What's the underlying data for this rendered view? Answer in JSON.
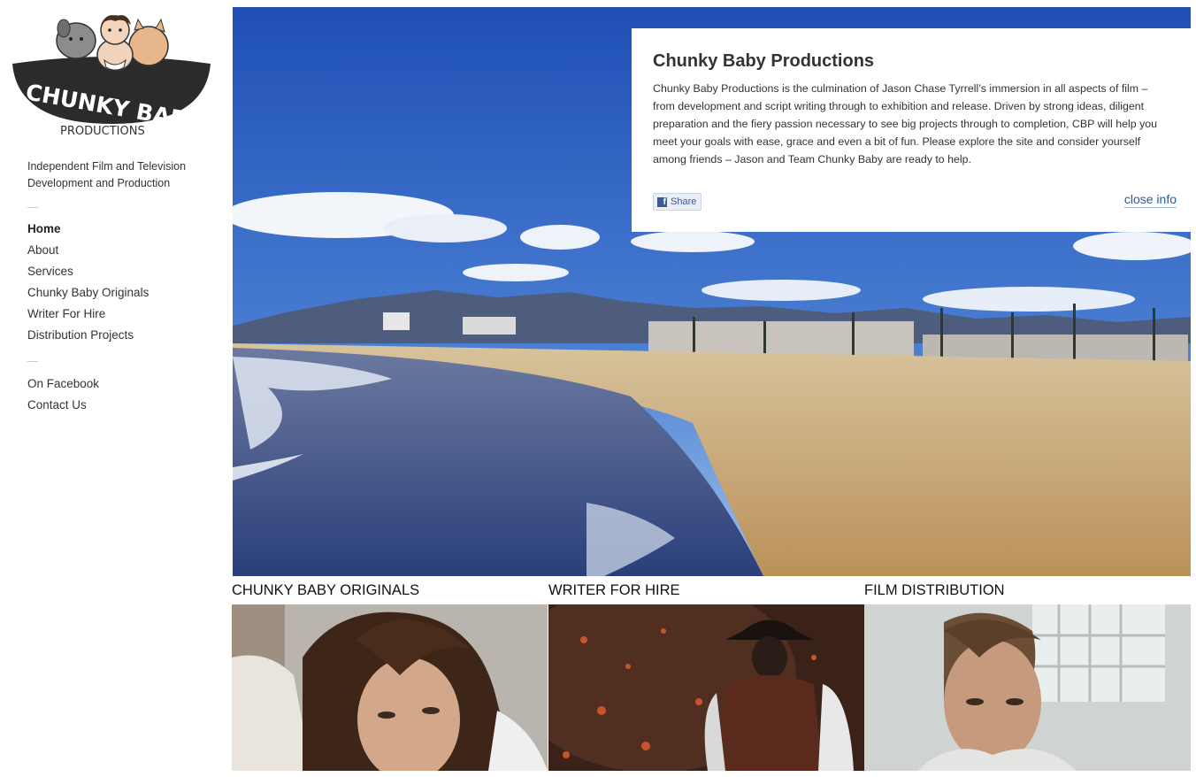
{
  "logo": {
    "top_text": "CHUNKY BABY",
    "bottom_text": "PRODUCTIONS"
  },
  "sidebar": {
    "tagline": "Independent Film and Television Development and Production",
    "nav": [
      {
        "label": "Home",
        "active": true
      },
      {
        "label": "About"
      },
      {
        "label": "Services"
      },
      {
        "label": "Chunky Baby Originals"
      },
      {
        "label": "Writer For Hire"
      },
      {
        "label": "Distribution Projects"
      }
    ],
    "social": [
      {
        "label": "On Facebook"
      },
      {
        "label": "Contact Us"
      }
    ]
  },
  "info": {
    "title": "Chunky Baby Productions",
    "body": "Chunky Baby Productions is the culmination of Jason Chase Tyrrell’s immersion in all aspects of film – from development and script writing through to exhibition and release. Driven by strong ideas, diligent preparation and the fiery passion necessary to see big projects through to completion, CBP will help you meet your goals with ease, grace and even a bit of fun. Please explore the site and consider yourself among friends – Jason and Team Chunky Baby are ready to help.",
    "share_label": "Share",
    "close_label": "close info"
  },
  "tiles": [
    {
      "title": "CHUNKY BABY ORIGINALS"
    },
    {
      "title": "WRITER FOR HIRE"
    },
    {
      "title": "FILM DISTRIBUTION"
    }
  ],
  "colors": {
    "link_blue": "#2a5a9a",
    "facebook_blue": "#3b5998",
    "sky": "#2d62c2",
    "sand": "#c9a86a",
    "ocean": "#3a4e86"
  }
}
